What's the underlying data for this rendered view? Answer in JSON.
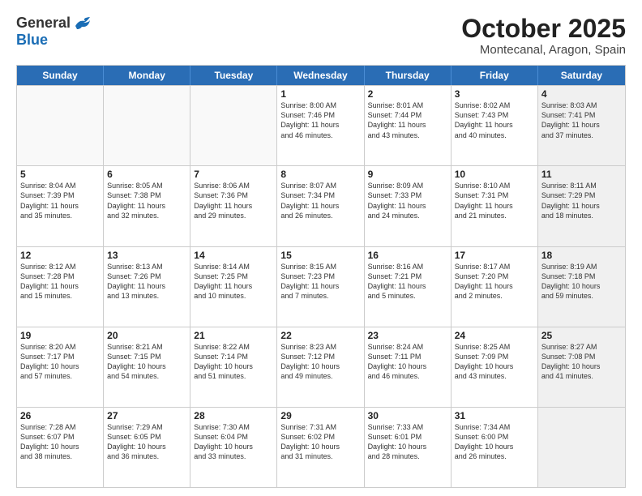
{
  "logo": {
    "general": "General",
    "blue": "Blue"
  },
  "title": "October 2025",
  "location": "Montecanal, Aragon, Spain",
  "weekdays": [
    "Sunday",
    "Monday",
    "Tuesday",
    "Wednesday",
    "Thursday",
    "Friday",
    "Saturday"
  ],
  "rows": [
    [
      {
        "day": "",
        "text": "",
        "empty": true
      },
      {
        "day": "",
        "text": "",
        "empty": true
      },
      {
        "day": "",
        "text": "",
        "empty": true
      },
      {
        "day": "1",
        "text": "Sunrise: 8:00 AM\nSunset: 7:46 PM\nDaylight: 11 hours\nand 46 minutes."
      },
      {
        "day": "2",
        "text": "Sunrise: 8:01 AM\nSunset: 7:44 PM\nDaylight: 11 hours\nand 43 minutes."
      },
      {
        "day": "3",
        "text": "Sunrise: 8:02 AM\nSunset: 7:43 PM\nDaylight: 11 hours\nand 40 minutes."
      },
      {
        "day": "4",
        "text": "Sunrise: 8:03 AM\nSunset: 7:41 PM\nDaylight: 11 hours\nand 37 minutes.",
        "shaded": true
      }
    ],
    [
      {
        "day": "5",
        "text": "Sunrise: 8:04 AM\nSunset: 7:39 PM\nDaylight: 11 hours\nand 35 minutes."
      },
      {
        "day": "6",
        "text": "Sunrise: 8:05 AM\nSunset: 7:38 PM\nDaylight: 11 hours\nand 32 minutes."
      },
      {
        "day": "7",
        "text": "Sunrise: 8:06 AM\nSunset: 7:36 PM\nDaylight: 11 hours\nand 29 minutes."
      },
      {
        "day": "8",
        "text": "Sunrise: 8:07 AM\nSunset: 7:34 PM\nDaylight: 11 hours\nand 26 minutes."
      },
      {
        "day": "9",
        "text": "Sunrise: 8:09 AM\nSunset: 7:33 PM\nDaylight: 11 hours\nand 24 minutes."
      },
      {
        "day": "10",
        "text": "Sunrise: 8:10 AM\nSunset: 7:31 PM\nDaylight: 11 hours\nand 21 minutes."
      },
      {
        "day": "11",
        "text": "Sunrise: 8:11 AM\nSunset: 7:29 PM\nDaylight: 11 hours\nand 18 minutes.",
        "shaded": true
      }
    ],
    [
      {
        "day": "12",
        "text": "Sunrise: 8:12 AM\nSunset: 7:28 PM\nDaylight: 11 hours\nand 15 minutes."
      },
      {
        "day": "13",
        "text": "Sunrise: 8:13 AM\nSunset: 7:26 PM\nDaylight: 11 hours\nand 13 minutes."
      },
      {
        "day": "14",
        "text": "Sunrise: 8:14 AM\nSunset: 7:25 PM\nDaylight: 11 hours\nand 10 minutes."
      },
      {
        "day": "15",
        "text": "Sunrise: 8:15 AM\nSunset: 7:23 PM\nDaylight: 11 hours\nand 7 minutes."
      },
      {
        "day": "16",
        "text": "Sunrise: 8:16 AM\nSunset: 7:21 PM\nDaylight: 11 hours\nand 5 minutes."
      },
      {
        "day": "17",
        "text": "Sunrise: 8:17 AM\nSunset: 7:20 PM\nDaylight: 11 hours\nand 2 minutes."
      },
      {
        "day": "18",
        "text": "Sunrise: 8:19 AM\nSunset: 7:18 PM\nDaylight: 10 hours\nand 59 minutes.",
        "shaded": true
      }
    ],
    [
      {
        "day": "19",
        "text": "Sunrise: 8:20 AM\nSunset: 7:17 PM\nDaylight: 10 hours\nand 57 minutes."
      },
      {
        "day": "20",
        "text": "Sunrise: 8:21 AM\nSunset: 7:15 PM\nDaylight: 10 hours\nand 54 minutes."
      },
      {
        "day": "21",
        "text": "Sunrise: 8:22 AM\nSunset: 7:14 PM\nDaylight: 10 hours\nand 51 minutes."
      },
      {
        "day": "22",
        "text": "Sunrise: 8:23 AM\nSunset: 7:12 PM\nDaylight: 10 hours\nand 49 minutes."
      },
      {
        "day": "23",
        "text": "Sunrise: 8:24 AM\nSunset: 7:11 PM\nDaylight: 10 hours\nand 46 minutes."
      },
      {
        "day": "24",
        "text": "Sunrise: 8:25 AM\nSunset: 7:09 PM\nDaylight: 10 hours\nand 43 minutes."
      },
      {
        "day": "25",
        "text": "Sunrise: 8:27 AM\nSunset: 7:08 PM\nDaylight: 10 hours\nand 41 minutes.",
        "shaded": true
      }
    ],
    [
      {
        "day": "26",
        "text": "Sunrise: 7:28 AM\nSunset: 6:07 PM\nDaylight: 10 hours\nand 38 minutes."
      },
      {
        "day": "27",
        "text": "Sunrise: 7:29 AM\nSunset: 6:05 PM\nDaylight: 10 hours\nand 36 minutes."
      },
      {
        "day": "28",
        "text": "Sunrise: 7:30 AM\nSunset: 6:04 PM\nDaylight: 10 hours\nand 33 minutes."
      },
      {
        "day": "29",
        "text": "Sunrise: 7:31 AM\nSunset: 6:02 PM\nDaylight: 10 hours\nand 31 minutes."
      },
      {
        "day": "30",
        "text": "Sunrise: 7:33 AM\nSunset: 6:01 PM\nDaylight: 10 hours\nand 28 minutes."
      },
      {
        "day": "31",
        "text": "Sunrise: 7:34 AM\nSunset: 6:00 PM\nDaylight: 10 hours\nand 26 minutes."
      },
      {
        "day": "",
        "text": "",
        "empty": true,
        "shaded": true
      }
    ]
  ]
}
